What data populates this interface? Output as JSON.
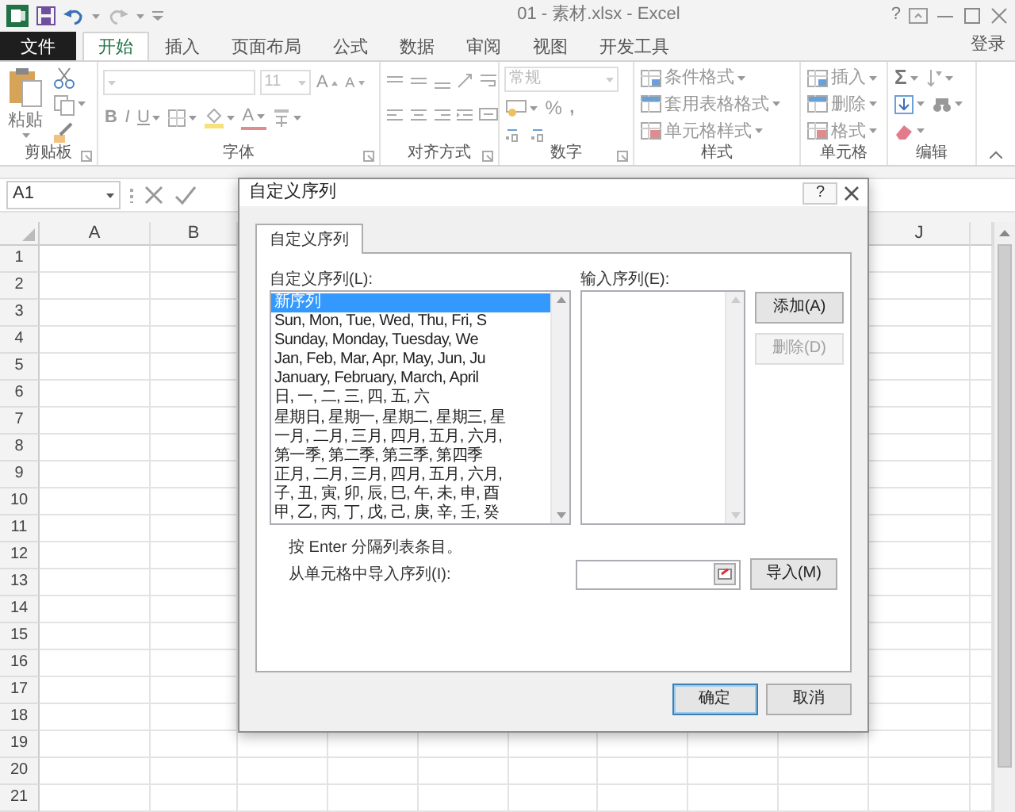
{
  "title_bar": {
    "title": "01 - 素材.xlsx - Excel",
    "help": "?"
  },
  "ribbon_tabs": [
    {
      "label": "文件",
      "kind": "file",
      "selected": false
    },
    {
      "label": "开始",
      "kind": "tab",
      "selected": true
    },
    {
      "label": "插入",
      "kind": "tab",
      "selected": false
    },
    {
      "label": "页面布局",
      "kind": "tab",
      "selected": false
    },
    {
      "label": "公式",
      "kind": "tab",
      "selected": false
    },
    {
      "label": "数据",
      "kind": "tab",
      "selected": false
    },
    {
      "label": "审阅",
      "kind": "tab",
      "selected": false
    },
    {
      "label": "视图",
      "kind": "tab",
      "selected": false
    },
    {
      "label": "开发工具",
      "kind": "tab",
      "selected": false
    }
  ],
  "sign_in": "登录",
  "ribbon_groups": [
    {
      "label": "剪贴板",
      "launcher": true,
      "commands": [
        "粘贴"
      ]
    },
    {
      "label": "字体",
      "launcher": true,
      "commands": [
        "11",
        "A",
        "A",
        "B",
        "I",
        "U",
        "A"
      ]
    },
    {
      "label": "对齐方式",
      "launcher": true
    },
    {
      "label": "数字",
      "launcher": true,
      "commands": [
        "常规",
        "%",
        ","
      ]
    },
    {
      "label": "样式",
      "launcher": false,
      "commands": [
        "条件格式",
        "套用表格格式",
        "单元格样式"
      ]
    },
    {
      "label": "单元格",
      "launcher": false,
      "commands": [
        "插入",
        "删除",
        "格式"
      ]
    },
    {
      "label": "编辑",
      "launcher": false,
      "commands": [
        "Σ"
      ]
    }
  ],
  "formula_bar": {
    "name_box": "A1"
  },
  "grid": {
    "columns": [
      {
        "label": "A"
      },
      {
        "label": "B"
      },
      {
        "label": "J"
      }
    ],
    "rows": [
      "1",
      "2",
      "3",
      "4",
      "5",
      "6",
      "7",
      "8",
      "9",
      "10",
      "11",
      "12",
      "13",
      "14",
      "15",
      "16",
      "17",
      "18",
      "19",
      "20",
      "21"
    ]
  },
  "dialog": {
    "title": "自定义序列",
    "help": "?",
    "tabs": [
      {
        "label": "自定义序列",
        "selected": true
      }
    ],
    "list_label": "自定义序列(L):",
    "list_items": [
      {
        "text": "新序列",
        "selected": true
      },
      {
        "text": "Sun, Mon, Tue, Wed, Thu, Fri, S",
        "selected": false
      },
      {
        "text": "Sunday, Monday, Tuesday, We",
        "selected": false
      },
      {
        "text": "Jan, Feb, Mar, Apr, May, Jun, Ju",
        "selected": false
      },
      {
        "text": "January, February, March, April",
        "selected": false
      },
      {
        "text": "日, 一, 二, 三, 四, 五, 六",
        "selected": false
      },
      {
        "text": "星期日, 星期一, 星期二, 星期三, 星",
        "selected": false
      },
      {
        "text": "一月, 二月, 三月, 四月, 五月, 六月,",
        "selected": false
      },
      {
        "text": "第一季, 第二季, 第三季, 第四季",
        "selected": false
      },
      {
        "text": "正月, 二月, 三月, 四月, 五月, 六月,",
        "selected": false
      },
      {
        "text": "子, 丑, 寅, 卯, 辰, 巳, 午, 未, 申, 酉",
        "selected": false
      },
      {
        "text": "甲, 乙, 丙, 丁, 戊, 己, 庚, 辛, 壬, 癸",
        "selected": false
      }
    ],
    "entries_label": "输入序列(E):",
    "side_buttons": [
      {
        "label": "添加(A)",
        "disabled": false
      },
      {
        "label": "删除(D)",
        "disabled": true
      }
    ],
    "hint": "按 Enter 分隔列表条目。",
    "import_label": "从单元格中导入序列(I):",
    "import_button": "导入(M)",
    "footer_buttons": [
      {
        "label": "确定",
        "default": true
      },
      {
        "label": "取消",
        "default": false
      }
    ]
  }
}
